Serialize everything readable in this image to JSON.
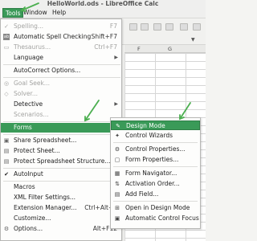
{
  "window": {
    "title": "HelloWorld.ods - LibreOffice Calc"
  },
  "menubar": {
    "tools": "Tools",
    "window": "Window",
    "help": "Help"
  },
  "grid": {
    "columns": [
      "F",
      "G"
    ]
  },
  "tools_menu": {
    "items": [
      {
        "label": "Spelling...",
        "shortcut": "F7",
        "disabled": true
      },
      {
        "label": "Automatic Spell Checking",
        "shortcut": "Shift+F7",
        "disabled": false
      },
      {
        "label": "Thesaurus...",
        "shortcut": "Ctrl+F7",
        "disabled": true
      },
      {
        "label": "Language",
        "shortcut": "",
        "disabled": false
      },
      {
        "label": "AutoCorrect Options...",
        "shortcut": "",
        "disabled": false
      },
      {
        "label": "Goal Seek...",
        "shortcut": "",
        "disabled": true
      },
      {
        "label": "Solver...",
        "shortcut": "",
        "disabled": true
      },
      {
        "label": "Detective",
        "shortcut": "",
        "disabled": false
      },
      {
        "label": "Scenarios...",
        "shortcut": "",
        "disabled": true
      },
      {
        "label": "Forms",
        "shortcut": "",
        "disabled": false
      },
      {
        "label": "Share Spreadsheet...",
        "shortcut": "",
        "disabled": false
      },
      {
        "label": "Protect Sheet...",
        "shortcut": "",
        "disabled": false
      },
      {
        "label": "Protect Spreadsheet Structure...",
        "shortcut": "",
        "disabled": false
      },
      {
        "label": "AutoInput",
        "shortcut": "",
        "disabled": false
      },
      {
        "label": "Macros",
        "shortcut": "",
        "disabled": false
      },
      {
        "label": "XML Filter Settings...",
        "shortcut": "",
        "disabled": false
      },
      {
        "label": "Extension Manager...",
        "shortcut": "Ctrl+Alt+E",
        "disabled": false
      },
      {
        "label": "Customize...",
        "shortcut": "",
        "disabled": false
      },
      {
        "label": "Options...",
        "shortcut": "Alt+F12",
        "disabled": false
      }
    ]
  },
  "forms_menu": {
    "items": [
      {
        "label": "Design Mode"
      },
      {
        "label": "Control Wizards"
      },
      {
        "label": "Control Properties..."
      },
      {
        "label": "Form Properties..."
      },
      {
        "label": "Form Navigator..."
      },
      {
        "label": "Activation Order..."
      },
      {
        "label": "Add Field..."
      },
      {
        "label": "Open in Design Mode"
      },
      {
        "label": "Automatic Control Focus"
      }
    ]
  },
  "colors": {
    "highlight": "#3a9a58",
    "arrow": "#4caf50"
  },
  "icons": {
    "spelling": "spellcheck-icon",
    "auto_spell": "abc-icon",
    "thesaurus": "book-icon",
    "goal_seek": "target-icon",
    "solver": "solver-icon",
    "detective": "magnifier-icon",
    "share": "share-icon",
    "protect_sheet": "lock-icon",
    "protect_structure": "lock-icon",
    "autoinput": "checkmark-icon",
    "macros": "macro-icon",
    "options": "gear-icon",
    "design_mode": "design-mode-icon",
    "control_wizards": "wand-icon",
    "control_properties": "gear-icon",
    "form_properties": "form-icon",
    "form_navigator": "navigator-icon",
    "activation_order": "order-icon",
    "add_field": "add-field-icon",
    "open_design": "design-icon",
    "auto_focus": "focus-icon"
  }
}
